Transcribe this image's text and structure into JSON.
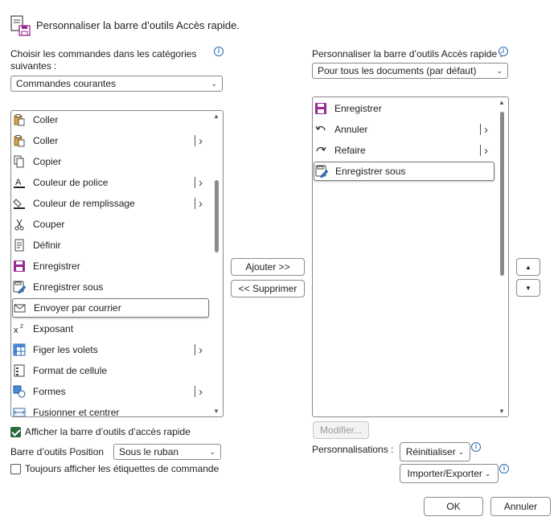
{
  "dialog": {
    "title": "Personnaliser la barre d’outils Accès rapide."
  },
  "left": {
    "choose_label_line1": "Choisir les commandes dans les catégories",
    "choose_label_line2": "suivantes :",
    "category_value": "Commandes courantes",
    "items": [
      {
        "label": "Coller",
        "icon": "clipboard-paste-icon",
        "submenu": false
      },
      {
        "label": "Coller",
        "icon": "clipboard-paste-icon",
        "submenu": true
      },
      {
        "label": "Copier",
        "icon": "copy-icon",
        "submenu": false
      },
      {
        "label": "Couleur de police",
        "icon": "font-color-icon",
        "submenu": true
      },
      {
        "label": "Couleur de remplissage",
        "icon": "fill-color-icon",
        "submenu": true
      },
      {
        "label": "Couper",
        "icon": "scissors-icon",
        "submenu": false
      },
      {
        "label": "Définir",
        "icon": "define-icon",
        "submenu": false
      },
      {
        "label": "Enregistrer",
        "icon": "save-icon",
        "submenu": false
      },
      {
        "label": "Enregistrer sous",
        "icon": "save-as-icon",
        "submenu": false
      },
      {
        "label": "Envoyer par courrier",
        "icon": "mail-icon",
        "submenu": false,
        "selected": true
      },
      {
        "label": "Exposant",
        "icon": "superscript-icon",
        "submenu": false
      },
      {
        "label": "Figer les volets",
        "icon": "freeze-panes-icon",
        "submenu": true
      },
      {
        "label": "Format de cellule",
        "icon": "format-cells-icon",
        "submenu": false
      },
      {
        "label": "Formes",
        "icon": "shapes-icon",
        "submenu": true
      },
      {
        "label": "Fusionner et centrer",
        "icon": "merge-center-icon",
        "submenu": false
      }
    ],
    "show_toolbar_label": "Afficher la barre d’outils d’accès rapide",
    "show_toolbar_checked": true,
    "position_label": "Barre d’outils Position",
    "position_value": "Sous le ruban",
    "always_labels_label": "Toujours afficher les étiquettes de commande",
    "always_labels_checked": false
  },
  "middle": {
    "add_label": "Ajouter >>",
    "remove_label": "<< Supprimer"
  },
  "right": {
    "customize_label": "Personnaliser la barre d’outils Accès rapide :",
    "scope_value": "Pour tous les documents (par défaut)",
    "items": [
      {
        "label": "Enregistrer",
        "icon": "save-icon",
        "submenu": false
      },
      {
        "label": "Annuler",
        "icon": "undo-icon",
        "submenu": true
      },
      {
        "label": "Refaire",
        "icon": "redo-icon",
        "submenu": true
      },
      {
        "label": "Enregistrer sous",
        "icon": "save-as-icon",
        "submenu": false,
        "selected": true
      }
    ],
    "modify_label": "Modifier...",
    "customizations_label": "Personnalisations :",
    "reset_label": "Réinitialiser",
    "import_export_label": "Importer/Exporter"
  },
  "footer": {
    "ok_label": "OK",
    "cancel_label": "Annuler"
  },
  "colors": {
    "accent_green": "#2b6b3a",
    "save_purple": "#9b2a8f",
    "info_blue": "#2b6cb0"
  }
}
